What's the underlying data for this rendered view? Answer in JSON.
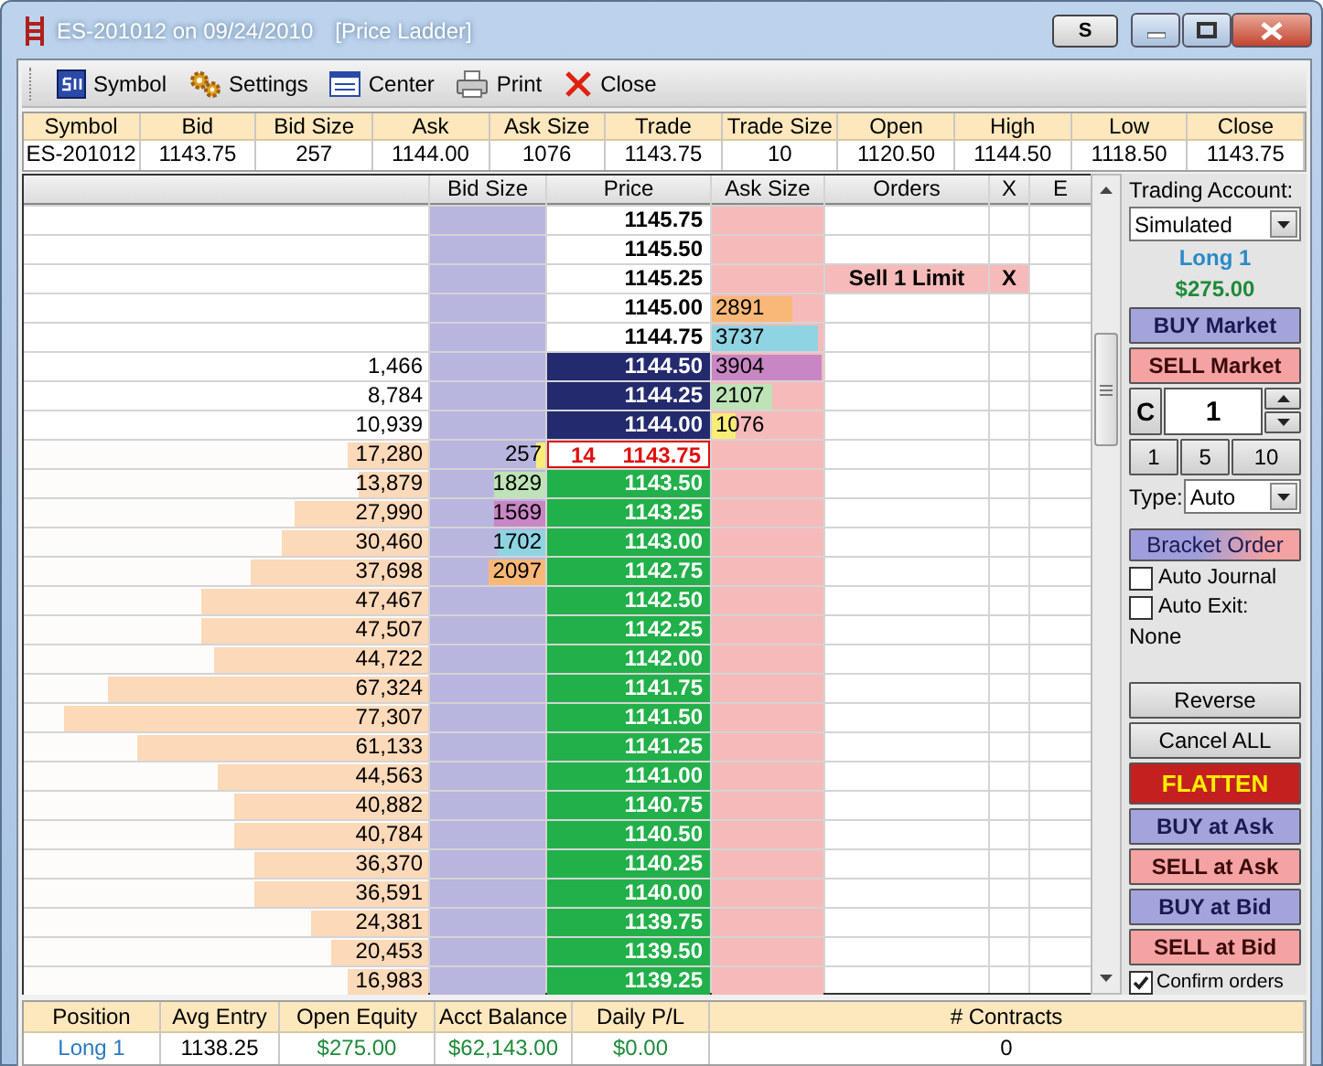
{
  "window": {
    "title": "ES-201012 on 09/24/2010",
    "subtitle": "[Price Ladder]",
    "s_button": "S"
  },
  "toolbar": [
    {
      "label": "Symbol",
      "kind": "symbol"
    },
    {
      "label": "Settings",
      "kind": "settings"
    },
    {
      "label": "Center",
      "kind": "center"
    },
    {
      "label": "Print",
      "kind": "print"
    },
    {
      "label": "Close",
      "kind": "close"
    }
  ],
  "quote": {
    "columns": [
      "Symbol",
      "Bid",
      "Bid Size",
      "Ask",
      "Ask Size",
      "Trade",
      "Trade Size",
      "Open",
      "High",
      "Low",
      "Close"
    ],
    "values": [
      "ES-201012",
      "1143.75",
      "257",
      "1144.00",
      "1076",
      "1143.75",
      "10",
      "1120.50",
      "1144.50",
      "1118.50",
      "1143.75"
    ]
  },
  "ladder": {
    "columns": [
      "Bid Size",
      "Price",
      "Ask Size",
      "Orders",
      "X",
      "E"
    ],
    "rows": [
      {
        "price": "1145.75",
        "kind": "plain"
      },
      {
        "price": "1145.50",
        "kind": "plain"
      },
      {
        "price": "1145.25",
        "kind": "plain",
        "order": {
          "label": "Sell 1 Limit",
          "cancel": "X"
        }
      },
      {
        "price": "1145.00",
        "kind": "plain",
        "ask": {
          "size": "2891",
          "color": "#f9b877",
          "level": 0.72
        }
      },
      {
        "price": "1144.75",
        "kind": "plain",
        "ask": {
          "size": "3737",
          "color": "#8fd4e2",
          "level": 0.95
        }
      },
      {
        "volume": "1,466",
        "price": "1144.50",
        "kind": "ask",
        "ask": {
          "size": "3904",
          "color": "#c986c4",
          "level": 0.98
        }
      },
      {
        "volume": "8,784",
        "price": "1144.25",
        "kind": "ask",
        "ask": {
          "size": "2107",
          "color": "#bde3b6",
          "level": 0.54
        }
      },
      {
        "volume": "10,939",
        "price": "1144.00",
        "kind": "ask",
        "ask": {
          "size": "1076",
          "color": "#f9ec78",
          "level": 0.22
        }
      },
      {
        "volume": "17,280",
        "level": 0.2,
        "price": "1143.75",
        "kind": "last",
        "trade_size": "14",
        "bid": {
          "size": "257",
          "color": "#f9ec78",
          "level": 0.08
        }
      },
      {
        "volume": "13,879",
        "level": 0.17,
        "price": "1143.50",
        "kind": "bid",
        "bid": {
          "size": "1829",
          "color": "#bde3b6",
          "level": 0.45
        }
      },
      {
        "volume": "27,990",
        "level": 0.33,
        "price": "1143.25",
        "kind": "bid",
        "bid": {
          "size": "1569",
          "color": "#c986c4",
          "level": 0.45
        }
      },
      {
        "volume": "30,460",
        "level": 0.36,
        "price": "1143.00",
        "kind": "bid",
        "bid": {
          "size": "1702",
          "color": "#8fd4e2",
          "level": 0.42
        }
      },
      {
        "volume": "37,698",
        "level": 0.44,
        "price": "1142.75",
        "kind": "bid",
        "bid": {
          "size": "2097",
          "color": "#f9b877",
          "level": 0.5
        }
      },
      {
        "volume": "47,467",
        "level": 0.56,
        "price": "1142.50",
        "kind": "bid"
      },
      {
        "volume": "47,507",
        "level": 0.56,
        "price": "1142.25",
        "kind": "bid"
      },
      {
        "volume": "44,722",
        "level": 0.53,
        "price": "1142.00",
        "kind": "bid"
      },
      {
        "volume": "67,324",
        "level": 0.79,
        "price": "1141.75",
        "kind": "bid"
      },
      {
        "volume": "77,307",
        "level": 0.9,
        "price": "1141.50",
        "kind": "bid"
      },
      {
        "volume": "61,133",
        "level": 0.72,
        "price": "1141.25",
        "kind": "bid"
      },
      {
        "volume": "44,563",
        "level": 0.52,
        "price": "1141.00",
        "kind": "bid"
      },
      {
        "volume": "40,882",
        "level": 0.48,
        "price": "1140.75",
        "kind": "bid"
      },
      {
        "volume": "40,784",
        "level": 0.48,
        "price": "1140.50",
        "kind": "bid"
      },
      {
        "volume": "36,370",
        "level": 0.43,
        "price": "1140.25",
        "kind": "bid"
      },
      {
        "volume": "36,591",
        "level": 0.43,
        "price": "1140.00",
        "kind": "bid"
      },
      {
        "volume": "24,381",
        "level": 0.29,
        "price": "1139.75",
        "kind": "bid"
      },
      {
        "volume": "20,453",
        "level": 0.24,
        "price": "1139.50",
        "kind": "bid"
      },
      {
        "volume": "16,983",
        "level": 0.2,
        "price": "1139.25",
        "kind": "bid"
      }
    ]
  },
  "side": {
    "account_label": "Trading Account:",
    "account": "Simulated",
    "position": "Long 1",
    "pnl": "$275.00",
    "market_buttons": [
      {
        "label": "BUY Market",
        "kind": "buy"
      },
      {
        "label": "SELL Market",
        "kind": "sell"
      }
    ],
    "quantity": {
      "clear": "C",
      "value": "1",
      "presets": [
        "1",
        "5",
        "10"
      ]
    },
    "order_type": {
      "label": "Type:",
      "value": "Auto"
    },
    "bracket": "Bracket Order",
    "options": [
      {
        "label": "Auto Journal",
        "checked": false
      },
      {
        "label": "Auto Exit:",
        "checked": false
      }
    ],
    "exit_strategy": "None",
    "actions": [
      {
        "label": "Reverse",
        "kind": "neutral"
      },
      {
        "label": "Cancel ALL",
        "kind": "neutral"
      },
      {
        "label": "FLATTEN",
        "kind": "flatten"
      },
      {
        "label": "BUY at Ask",
        "kind": "buy"
      },
      {
        "label": "SELL at Ask",
        "kind": "sell"
      },
      {
        "label": "BUY at Bid",
        "kind": "buy"
      },
      {
        "label": "SELL at Bid",
        "kind": "sell"
      }
    ],
    "confirm": {
      "label": "Confirm orders",
      "checked": true
    }
  },
  "position": {
    "columns": [
      "Position",
      "Avg Entry",
      "Open Equity",
      "Acct Balance",
      "Daily P/L",
      "# Contracts"
    ],
    "values": [
      {
        "text": "Long 1",
        "kind": "position"
      },
      {
        "text": "1138.25",
        "kind": "number"
      },
      {
        "text": "$275.00",
        "kind": "money"
      },
      {
        "text": "$62,143.00",
        "kind": "money"
      },
      {
        "text": "$0.00",
        "kind": "money"
      },
      {
        "text": "0",
        "kind": "number"
      }
    ]
  }
}
